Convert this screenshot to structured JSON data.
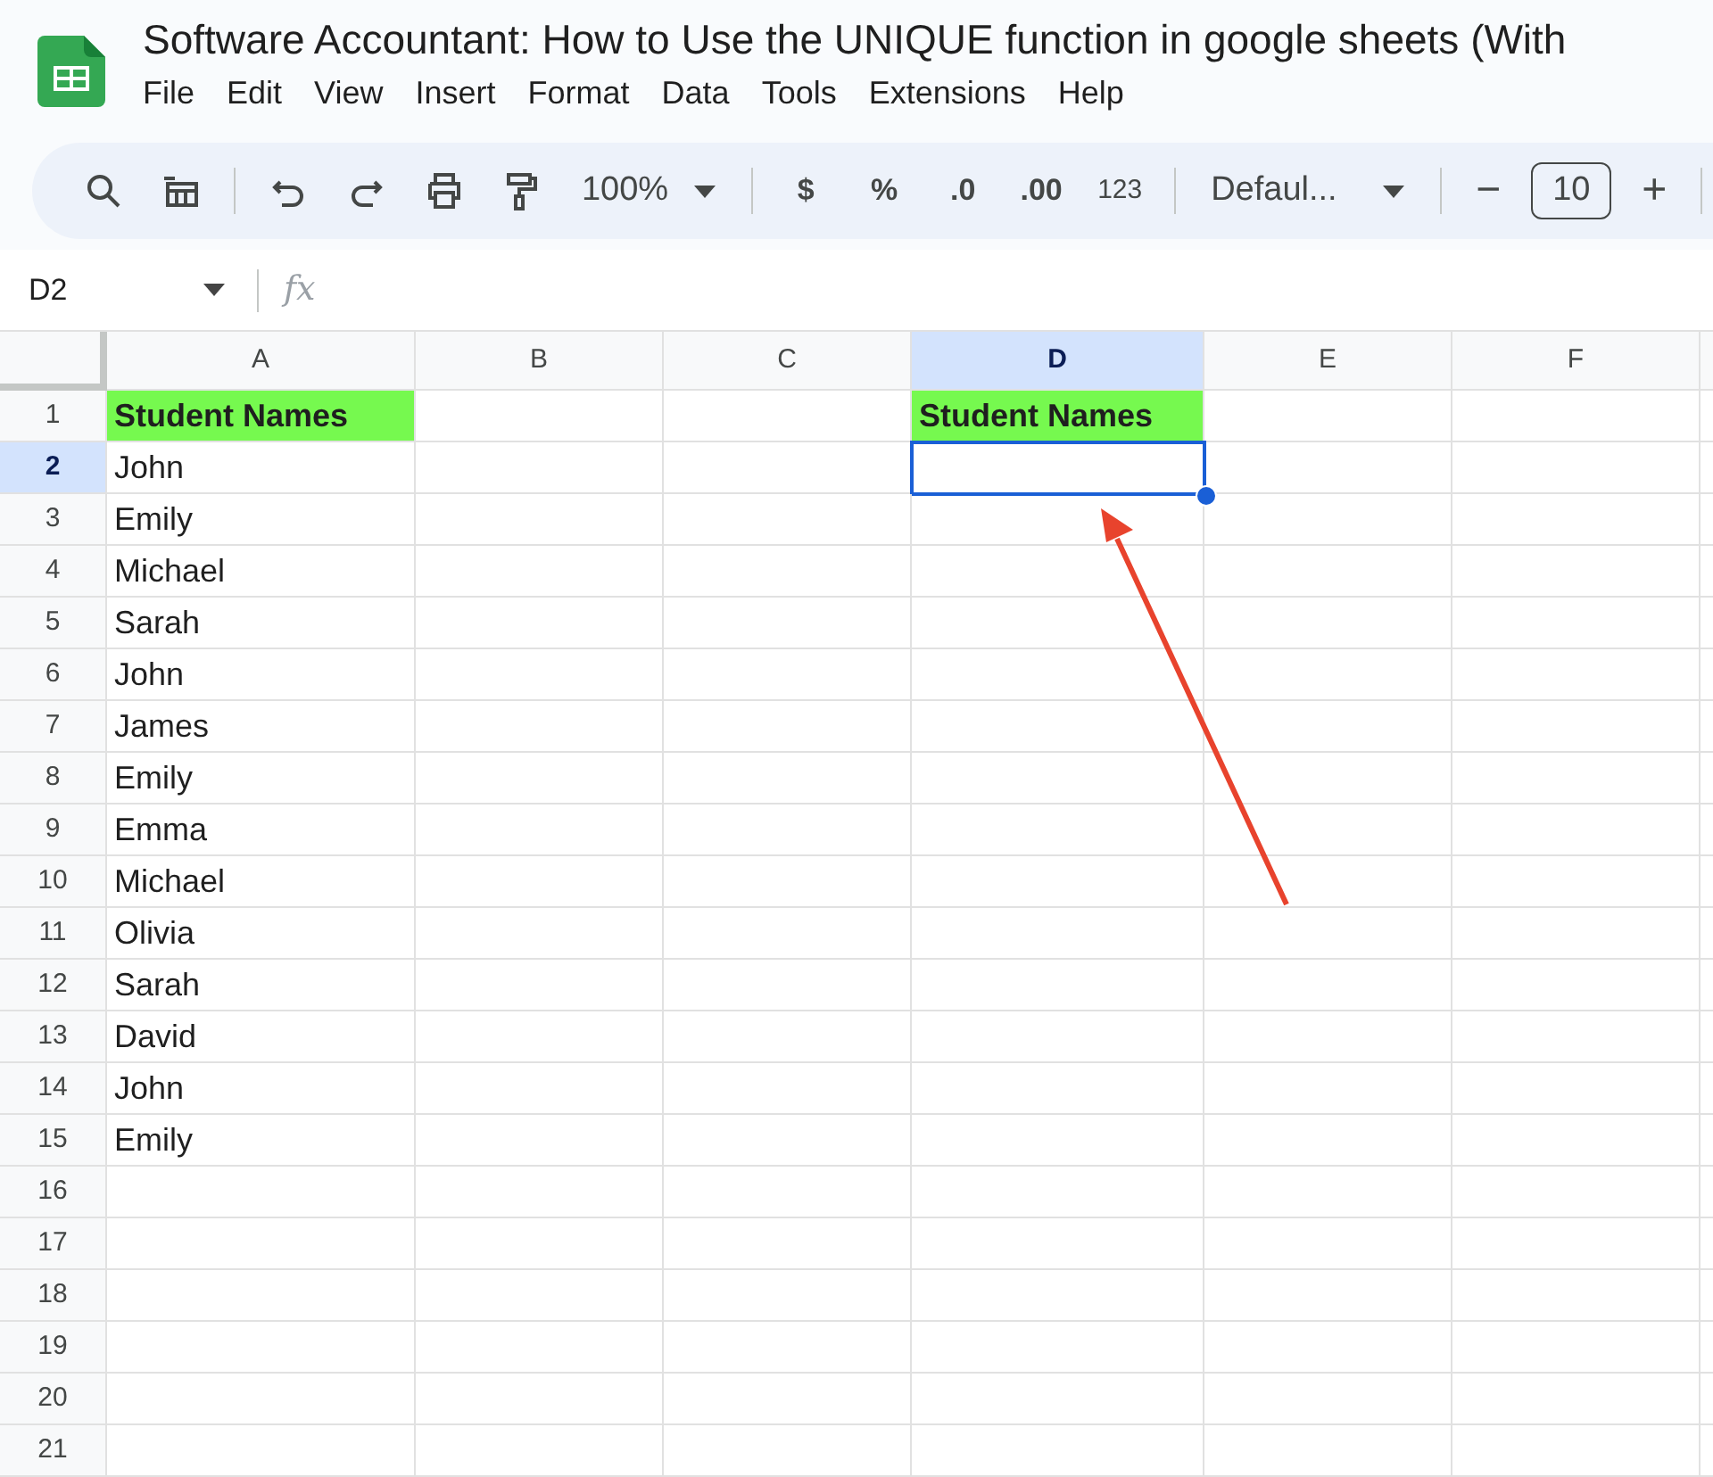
{
  "document": {
    "title": "Software Accountant: How to Use the UNIQUE function in google sheets (With"
  },
  "menu": [
    "File",
    "Edit",
    "View",
    "Insert",
    "Format",
    "Data",
    "Tools",
    "Extensions",
    "Help"
  ],
  "toolbar": {
    "zoom": "100%",
    "format_buttons": [
      "$",
      "%",
      ".0",
      ".00",
      "123"
    ],
    "font": "Defaul...",
    "font_size_minus": "−",
    "font_size": "10",
    "font_size_plus": "+"
  },
  "formula_bar": {
    "cell_ref": "D2",
    "fx": "fx"
  },
  "sheet": {
    "columns": [
      {
        "label": "A",
        "selected": false
      },
      {
        "label": "B",
        "selected": false
      },
      {
        "label": "C",
        "selected": false
      },
      {
        "label": "D",
        "selected": true
      },
      {
        "label": "E",
        "selected": false
      },
      {
        "label": "F",
        "selected": false
      }
    ],
    "rows": [
      {
        "label": "1",
        "selected": false,
        "cells": [
          {
            "text": "Student Names",
            "kind": "header",
            "selected": false
          },
          {
            "text": "",
            "kind": "plain",
            "selected": false
          },
          {
            "text": "",
            "kind": "plain",
            "selected": false
          },
          {
            "text": "Student Names",
            "kind": "header",
            "selected": false
          }
        ]
      },
      {
        "label": "2",
        "selected": true,
        "cells": [
          {
            "text": "John",
            "kind": "plain",
            "selected": false
          },
          {
            "text": "",
            "kind": "plain",
            "selected": false
          },
          {
            "text": "",
            "kind": "plain",
            "selected": false
          },
          {
            "text": "",
            "kind": "plain",
            "selected": true
          }
        ]
      },
      {
        "label": "3",
        "selected": false,
        "cells": [
          {
            "text": "Emily",
            "kind": "plain",
            "selected": false
          }
        ]
      },
      {
        "label": "4",
        "selected": false,
        "cells": [
          {
            "text": "Michael",
            "kind": "plain",
            "selected": false
          }
        ]
      },
      {
        "label": "5",
        "selected": false,
        "cells": [
          {
            "text": "Sarah",
            "kind": "plain",
            "selected": false
          }
        ]
      },
      {
        "label": "6",
        "selected": false,
        "cells": [
          {
            "text": "John",
            "kind": "plain",
            "selected": false
          }
        ]
      },
      {
        "label": "7",
        "selected": false,
        "cells": [
          {
            "text": "James",
            "kind": "plain",
            "selected": false
          }
        ]
      },
      {
        "label": "8",
        "selected": false,
        "cells": [
          {
            "text": "Emily",
            "kind": "plain",
            "selected": false
          }
        ]
      },
      {
        "label": "9",
        "selected": false,
        "cells": [
          {
            "text": "Emma",
            "kind": "plain",
            "selected": false
          }
        ]
      },
      {
        "label": "10",
        "selected": false,
        "cells": [
          {
            "text": "Michael",
            "kind": "plain",
            "selected": false
          }
        ]
      },
      {
        "label": "11",
        "selected": false,
        "cells": [
          {
            "text": "Olivia",
            "kind": "plain",
            "selected": false
          }
        ]
      },
      {
        "label": "12",
        "selected": false,
        "cells": [
          {
            "text": "Sarah",
            "kind": "plain",
            "selected": false
          }
        ]
      },
      {
        "label": "13",
        "selected": false,
        "cells": [
          {
            "text": "David",
            "kind": "plain",
            "selected": false
          }
        ]
      },
      {
        "label": "14",
        "selected": false,
        "cells": [
          {
            "text": "John",
            "kind": "plain",
            "selected": false
          }
        ]
      },
      {
        "label": "15",
        "selected": false,
        "cells": [
          {
            "text": "Emily",
            "kind": "plain",
            "selected": false
          }
        ]
      },
      {
        "label": "16",
        "selected": false,
        "cells": []
      },
      {
        "label": "17",
        "selected": false,
        "cells": []
      },
      {
        "label": "18",
        "selected": false,
        "cells": []
      },
      {
        "label": "19",
        "selected": false,
        "cells": []
      },
      {
        "label": "20",
        "selected": false,
        "cells": []
      },
      {
        "label": "21",
        "selected": false,
        "cells": []
      }
    ]
  },
  "annotation": {
    "kind": "arrow"
  }
}
